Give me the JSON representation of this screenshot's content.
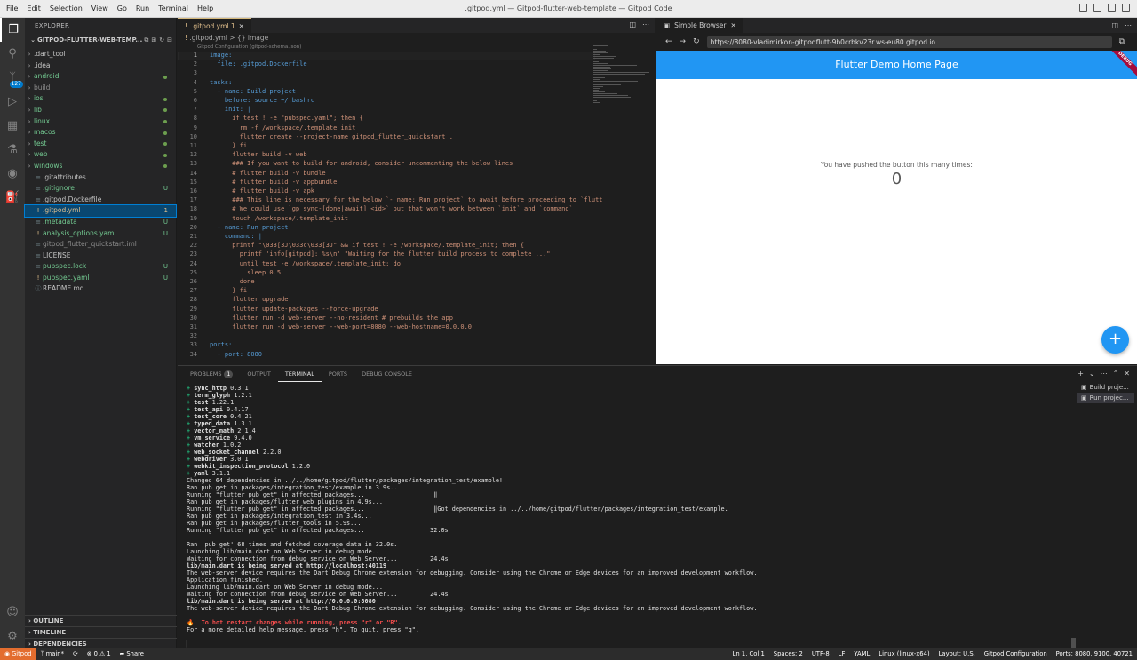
{
  "window": {
    "menu": [
      "File",
      "Edit",
      "Selection",
      "View",
      "Go",
      "Run",
      "Terminal",
      "Help"
    ],
    "title": ".gitpod.yml — Gitpod-flutter-web-template — Gitpod Code"
  },
  "activity": {
    "scm_badge": "127"
  },
  "explorer": {
    "header": "EXPLORER",
    "folder": "GITPOD-FLUTTER-WEB-TEMP...",
    "items": [
      {
        "label": ".dart_tool",
        "type": "folder",
        "color": "#c5c5c5",
        "status": ""
      },
      {
        "label": ".idea",
        "type": "folder",
        "color": "#c5c5c5",
        "status": ""
      },
      {
        "label": "android",
        "type": "folder",
        "color": "#73c991",
        "status": "dot"
      },
      {
        "label": "build",
        "type": "folder",
        "color": "#8c8c8c",
        "status": ""
      },
      {
        "label": "ios",
        "type": "folder",
        "color": "#73c991",
        "status": "dot"
      },
      {
        "label": "lib",
        "type": "folder",
        "color": "#73c991",
        "status": "dot"
      },
      {
        "label": "linux",
        "type": "folder",
        "color": "#73c991",
        "status": "dot"
      },
      {
        "label": "macos",
        "type": "folder",
        "color": "#73c991",
        "status": "dot"
      },
      {
        "label": "test",
        "type": "folder",
        "color": "#73c991",
        "status": "dot"
      },
      {
        "label": "web",
        "type": "folder",
        "color": "#73c991",
        "status": "dot"
      },
      {
        "label": "windows",
        "type": "folder",
        "color": "#73c991",
        "status": "dot"
      },
      {
        "label": ".gitattributes",
        "type": "file",
        "color": "#c5c5c5",
        "status": ""
      },
      {
        "label": ".gitignore",
        "type": "file",
        "color": "#73c991",
        "status": "U"
      },
      {
        "label": ".gitpod.Dockerfile",
        "type": "file",
        "color": "#c5c5c5",
        "status": ""
      },
      {
        "label": ".gitpod.yml",
        "type": "file",
        "color": "#e2c08d",
        "status": "1"
      },
      {
        "label": ".metadata",
        "type": "file",
        "color": "#73c991",
        "status": "U"
      },
      {
        "label": "analysis_options.yaml",
        "type": "file",
        "color": "#73c991",
        "status": "U"
      },
      {
        "label": "gitpod_flutter_quickstart.iml",
        "type": "file",
        "color": "#8c8c8c",
        "status": ""
      },
      {
        "label": "LICENSE",
        "type": "file",
        "color": "#c5c5c5",
        "status": ""
      },
      {
        "label": "pubspec.lock",
        "type": "file",
        "color": "#73c991",
        "status": "U"
      },
      {
        "label": "pubspec.yaml",
        "type": "file",
        "color": "#73c991",
        "status": "U"
      },
      {
        "label": "README.md",
        "type": "file",
        "color": "#c5c5c5",
        "status": ""
      }
    ],
    "sections": [
      "OUTLINE",
      "TIMELINE",
      "DEPENDENCIES"
    ]
  },
  "editor": {
    "tab": ".gitpod.yml 1",
    "breadcrumb": ".gitpod.yml > {} image",
    "schema_hint": "Gitpod Configuration (gitpod-schema.json)",
    "lines": [
      "image:",
      "  file: .gitpod.Dockerfile",
      "",
      "tasks:",
      "  - name: Build project",
      "    before: source ~/.bashrc",
      "    init: |",
      "      if test ! -e \"pubspec.yaml\"; then {",
      "        rm -f /workspace/.template_init",
      "        flutter create --project-name gitpod_flutter_quickstart .",
      "      } fi",
      "      flutter build -v web",
      "      ### If you want to build for android, consider uncommenting the below lines",
      "      # flutter build -v bundle",
      "      # flutter build -v appbundle",
      "      # flutter build -v apk",
      "      ### This line is necessary for the below `- name: Run project` to await before proceeding to `flutt",
      "      # We could use `gp sync-[done|await] <id>` but that won't work between `init` and `command`",
      "      touch /workspace/.template_init",
      "  - name: Run project",
      "    command: |",
      "      printf \"\\033[3J\\033c\\033[3J\" && if test ! -e /workspace/.template_init; then {",
      "        printf 'info[gitpod]: %s\\n' \"Waiting for the flutter build process to complete ...\"",
      "        until test -e /workspace/.template_init; do",
      "          sleep 0.5",
      "        done",
      "      } fi",
      "      flutter upgrade",
      "      flutter update-packages --force-upgrade",
      "      flutter run -d web-server --no-resident # prebuilds the app",
      "      flutter run -d web-server --web-port=8080 --web-hostname=0.0.0.0",
      "",
      "ports:",
      "  - port: 8080"
    ]
  },
  "browser": {
    "tab": "Simple Browser",
    "url": "https://8080-vladimirkon-gitpodflutt-9b0crbkv23r.ws-eu80.gitpod.io",
    "app_title": "Flutter Demo Home Page",
    "debug_banner": "DEBUG",
    "counter_label": "You have pushed the button this many times:",
    "counter_value": "0",
    "fab_icon": "+"
  },
  "panel": {
    "tabs": [
      {
        "label": "PROBLEMS",
        "badge": "1"
      },
      {
        "label": "OUTPUT",
        "badge": ""
      },
      {
        "label": "TERMINAL",
        "badge": ""
      },
      {
        "label": "PORTS",
        "badge": ""
      },
      {
        "label": "DEBUG CONSOLE",
        "badge": ""
      }
    ],
    "terminals": [
      "Build proje...",
      "Run projec..."
    ],
    "terminal_lines": [
      {
        "plus": "+ ",
        "bold": "sync_http",
        "rest": " 0.3.1"
      },
      {
        "plus": "+ ",
        "bold": "term_glyph",
        "rest": " 1.2.1"
      },
      {
        "plus": "+ ",
        "bold": "test",
        "rest": " 1.22.1"
      },
      {
        "plus": "+ ",
        "bold": "test_api",
        "rest": " 0.4.17"
      },
      {
        "plus": "+ ",
        "bold": "test_core",
        "rest": " 0.4.21"
      },
      {
        "plus": "+ ",
        "bold": "typed_data",
        "rest": " 1.3.1"
      },
      {
        "plus": "+ ",
        "bold": "vector_math",
        "rest": " 2.1.4"
      },
      {
        "plus": "+ ",
        "bold": "vm_service",
        "rest": " 9.4.0"
      },
      {
        "plus": "+ ",
        "bold": "watcher",
        "rest": " 1.0.2"
      },
      {
        "plus": "+ ",
        "bold": "web_socket_channel",
        "rest": " 2.2.0"
      },
      {
        "plus": "+ ",
        "bold": "webdriver",
        "rest": " 3.0.1"
      },
      {
        "plus": "+ ",
        "bold": "webkit_inspection_protocol",
        "rest": " 1.2.0"
      },
      {
        "plus": "+ ",
        "bold": "yaml",
        "rest": " 3.1.1"
      },
      {
        "plus": "",
        "bold": "",
        "rest": "Changed 64 dependencies in ../../home/gitpod/flutter/packages/integration_test/example!"
      },
      {
        "plus": "",
        "bold": "",
        "rest": "Ran pub get in packages/integration_test/example in 3.9s..."
      },
      {
        "plus": "",
        "bold": "",
        "rest": "Running \"flutter pub get\" in affected packages...                   ‖"
      },
      {
        "plus": "",
        "bold": "",
        "rest": "Ran pub get in packages/flutter_web_plugins in 4.9s..."
      },
      {
        "plus": "",
        "bold": "",
        "rest": "Running \"flutter pub get\" in affected packages...                   ‖Got dependencies in ../../home/gitpod/flutter/packages/integration_test/example."
      },
      {
        "plus": "",
        "bold": "",
        "rest": "Ran pub get in packages/integration_test in 3.4s..."
      },
      {
        "plus": "",
        "bold": "",
        "rest": "Ran pub get in packages/flutter_tools in 5.9s..."
      },
      {
        "plus": "",
        "bold": "",
        "rest": "Running \"flutter pub get\" in affected packages...                  32.0s"
      },
      {
        "plus": "",
        "bold": "",
        "rest": ""
      },
      {
        "plus": "",
        "bold": "",
        "rest": "Ran 'pub get' 68 times and fetched coverage data in 32.0s."
      },
      {
        "plus": "",
        "bold": "",
        "rest": "Launching lib/main.dart on Web Server in debug mode..."
      },
      {
        "plus": "",
        "bold": "",
        "rest": "Waiting for connection from debug service on Web Server...         24.4s"
      },
      {
        "plus": "",
        "bold": "lib/main.dart is being served at http://localhost:40119",
        "rest": ""
      },
      {
        "plus": "",
        "bold": "",
        "rest": "The web-server device requires the Dart Debug Chrome extension for debugging. Consider using the Chrome or Edge devices for an improved development workflow."
      },
      {
        "plus": "",
        "bold": "",
        "rest": "Application finished."
      },
      {
        "plus": "",
        "bold": "",
        "rest": "Launching lib/main.dart on Web Server in debug mode..."
      },
      {
        "plus": "",
        "bold": "",
        "rest": "Waiting for connection from debug service on Web Server...         24.4s"
      },
      {
        "plus": "",
        "bold": "lib/main.dart is being served at http://0.0.0.0:8080",
        "rest": ""
      },
      {
        "plus": "",
        "bold": "",
        "rest": "The web-server device requires the Dart Debug Chrome extension for debugging. Consider using the Chrome or Edge devices for an improved development workflow."
      },
      {
        "plus": "",
        "bold": "",
        "rest": ""
      },
      {
        "plus": "",
        "bold": "",
        "rest": "",
        "red": "🔥  To hot restart changes while running, press \"r\" or \"R\"."
      },
      {
        "plus": "",
        "bold": "",
        "rest": "For a more detailed help message, press \"h\". To quit, press \"q\"."
      },
      {
        "plus": "",
        "bold": "",
        "rest": ""
      },
      {
        "plus": "",
        "bold": "",
        "rest": "▏"
      }
    ]
  },
  "statusbar": {
    "remote": "Gitpod",
    "branch": "main*",
    "sync": "⟳",
    "problems": "⊗ 0 ⚠ 1",
    "share": "Share",
    "right": [
      "Ln 1, Col 1",
      "Spaces: 2",
      "UTF-8",
      "LF",
      "YAML",
      "Linux (linux-x64)",
      "Layout: U.S.",
      "Gitpod Configuration",
      "Ports: 8080, 9100, 40721"
    ]
  },
  "colors": {
    "accent": "#007acc",
    "flutter_blue": "#2196f3",
    "remote": "#e36d2f"
  }
}
